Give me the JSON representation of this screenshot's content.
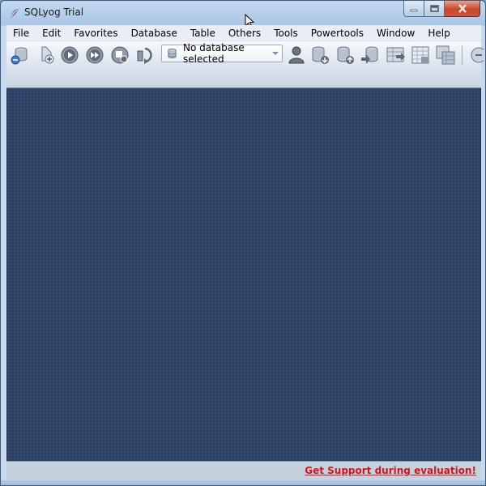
{
  "window": {
    "title": "SQLyog Trial"
  },
  "menu": [
    "File",
    "Edit",
    "Favorites",
    "Database",
    "Table",
    "Others",
    "Tools",
    "Powertools",
    "Window",
    "Help"
  ],
  "toolbar": {
    "database_select_value": "No database selected",
    "left_icons": [
      "new-connection-icon",
      "new-query-icon",
      "execute-query-icon",
      "execute-all-icon",
      "stop-icon",
      "refresh-icon"
    ],
    "right_icons": [
      "user-manager-icon",
      "backup-database-icon",
      "restore-database-icon",
      "copy-database-icon",
      "import-data-icon",
      "schema-table-icon",
      "copy-table-icon"
    ]
  },
  "status": {
    "support_link": "Get Support during evaluation!"
  },
  "colors": {
    "workspace": "#2e4466",
    "link": "#d0141c",
    "close_button": "#c7462c"
  }
}
